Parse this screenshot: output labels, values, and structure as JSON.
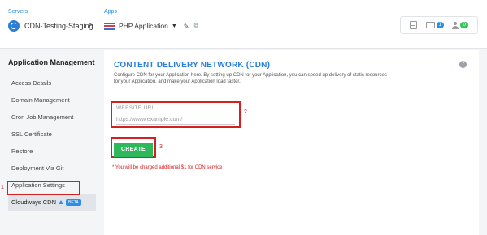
{
  "header": {
    "servers_label": "Servers",
    "server_name": "CDN-Testing-Staging.",
    "separator": ">",
    "apps_label": "Apps",
    "app_name": "PHP Application",
    "app_caret": "▼",
    "edit_icon": "pencil-icon",
    "external_icon": "external-link-icon",
    "widget": {
      "folder_count": "1",
      "users_count": "0"
    }
  },
  "sidebar": {
    "title": "Application Management",
    "items": [
      {
        "label": "Access Details"
      },
      {
        "label": "Domain Management"
      },
      {
        "label": "Cron Job Management"
      },
      {
        "label": "SSL Certificate"
      },
      {
        "label": "Restore"
      },
      {
        "label": "Deployment Via Git"
      },
      {
        "label": "Application Settings"
      },
      {
        "label": "Cloudways CDN",
        "badge": "BETA",
        "active": true
      }
    ]
  },
  "main": {
    "title": "CONTENT DELIVERY NETWORK (CDN)",
    "description": "Configure CDN for your Application here. By setting up CDN for your Application, you can speed up delivery of static resources for your Application, and make your Application load faster.",
    "help_icon": "?",
    "url_field": {
      "label": "WEBSITE URL",
      "placeholder": "https://www.example.com/",
      "value": ""
    },
    "create_button": "CREATE",
    "note": "* You will be charged additional $1 for CDN service"
  },
  "annotations": {
    "mark1": "1",
    "mark2": "2",
    "mark3": "3"
  },
  "colors": {
    "accent": "#2b7fd8",
    "create_button": "#2eb85c",
    "annotation_red": "#d32020"
  }
}
